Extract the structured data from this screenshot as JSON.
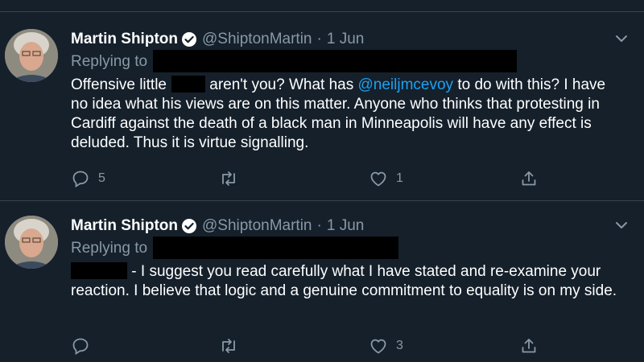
{
  "tweets": [
    {
      "author_name": "Martin Shipton",
      "handle": "@ShiptonMartin",
      "separator": "·",
      "date": "1 Jun",
      "replying_label": "Replying to",
      "text_part1": "Offensive little",
      "text_part2": " aren't you? What has ",
      "mention": "@neiljmcevoy",
      "text_part3": " to do with this? I have no idea what his views are on this matter. Anyone who thinks that protesting in Cardiff against the death of a black man in Minneapolis will have any effect is deluded. Thus it is virtue signalling.",
      "reply_count": "5",
      "retweet_count": "",
      "like_count": "1"
    },
    {
      "author_name": "Martin Shipton",
      "handle": "@ShiptonMartin",
      "separator": "·",
      "date": "1 Jun",
      "replying_label": "Replying to",
      "text": " - I suggest you read carefully what I have stated and re-examine your reaction. I believe that logic and a genuine commitment to equality is on my side.",
      "reply_count": "",
      "retweet_count": "",
      "like_count": "3"
    }
  ],
  "icons": {
    "reply": "reply-icon",
    "retweet": "retweet-icon",
    "like": "heart-icon",
    "share": "share-icon",
    "verified": "verified-badge-icon",
    "more": "chevron-down-icon"
  },
  "colors": {
    "background": "#15202b",
    "secondary_text": "#8899a6",
    "link": "#1da1f2",
    "divider": "#38444d"
  }
}
